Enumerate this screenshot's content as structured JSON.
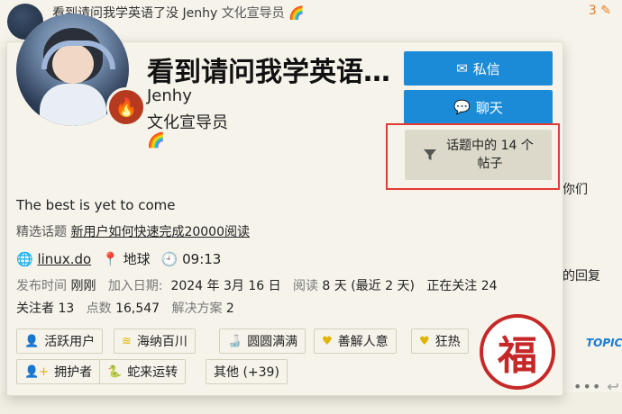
{
  "background": {
    "topic_title": "看到请问我学英语了没",
    "topic_author": "Jenhy",
    "topic_role": "文化宣导员",
    "topic_count": "3",
    "right_snippet_1": "你们",
    "right_snippet_2": "的回复",
    "right_snippet_3": "TOPIC"
  },
  "card": {
    "name": "看到请问我学英语了没",
    "username": "Jenhy",
    "title": "文化宣导员",
    "rainbow": "🌈",
    "bio": "The best is yet to come",
    "featured_label": "精选话题",
    "featured_topic": "新用户如何快速完成20000阅读",
    "website": "linux.do",
    "location": "地球",
    "local_time": "09:13",
    "stats": {
      "posted_label": "发布时间",
      "posted_value": "刚刚",
      "joined_label": "加入日期:",
      "joined_value": "2024 年 3月 16 日",
      "read_label": "阅读",
      "read_value": "8 天 (最近 2 天)",
      "following_label": "正在关注",
      "following_value": "24",
      "followers_label": "关注者",
      "followers_value": "13",
      "points_label": "点数",
      "points_value": "16,547",
      "solutions_label": "解决方案",
      "solutions_value": "2"
    },
    "buttons": {
      "message": "私信",
      "chat": "聊天",
      "filter_line1": "话题中的 14 个",
      "filter_line2": "帖子"
    },
    "badges": [
      {
        "label": "活跃用户",
        "icon": "user-icon"
      },
      {
        "label": "海纳百川",
        "icon": "waves-icon"
      },
      {
        "label": "圆圆满满",
        "icon": "bottle-icon"
      },
      {
        "label": "善解人意",
        "icon": "heart-icon"
      },
      {
        "label": "狂热",
        "icon": "heart-icon"
      },
      {
        "label": "拥护者",
        "icon": "user-plus-icon"
      },
      {
        "label": "蛇来运转",
        "icon": "snake-icon"
      },
      {
        "label": "其他 (+39)",
        "icon": ""
      }
    ],
    "stamp": "福"
  },
  "colors": {
    "accent": "#1b8bd8",
    "highlight": "#e53935",
    "stamp": "#c62828",
    "background": "#f6f3ea"
  }
}
